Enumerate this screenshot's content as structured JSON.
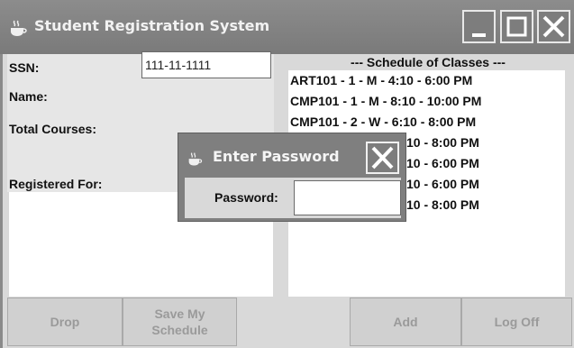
{
  "window": {
    "title": "Student Registration System",
    "icon": "java-cup-icon",
    "controls": [
      "minimize",
      "maximize",
      "close"
    ]
  },
  "form": {
    "ssn_label": "SSN:",
    "ssn_value": "111-11-1111",
    "name_label": "Name:",
    "total_courses_label": "Total Courses:",
    "registered_for_label": "Registered For:"
  },
  "schedule": {
    "title": "--- Schedule of Classes ---",
    "items": [
      "ART101 - 1 - M - 4:10 - 6:00 PM",
      "CMP101 - 1 - M - 8:10 - 10:00 PM",
      "CMP101 - 2 - W - 6:10 - 8:00 PM",
      "10 - 8:00 PM",
      "10 - 6:00 PM",
      "10 - 6:00 PM",
      "10 - 8:00 PM"
    ]
  },
  "buttons": {
    "drop": "Drop",
    "save_line1": "Save My",
    "save_line2": "Schedule",
    "add": "Add",
    "log_off": "Log Off"
  },
  "dialog": {
    "title": "Enter Password",
    "password_label": "Password:"
  },
  "colors": {
    "titlebar": "#808080",
    "panel": "#d9d9d9",
    "disabled_text": "#9a9a9a"
  }
}
